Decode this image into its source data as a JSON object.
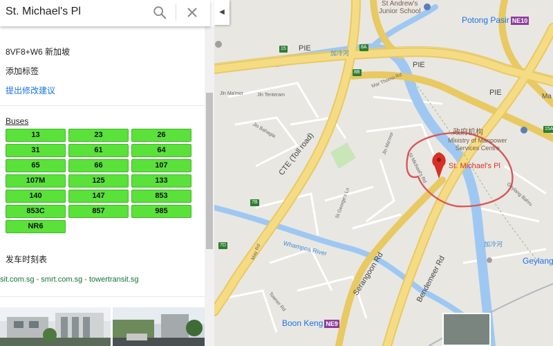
{
  "search": {
    "query": "St. Michael's Pl"
  },
  "place": {
    "plus_code": "8VF8+W6 新加坡",
    "add_label": "添加标签",
    "suggest_edit": "提出修改建议",
    "name_on_map": "St. Michael's Pl"
  },
  "buses": {
    "title": "Buses",
    "chip_color": "#5ae13a",
    "routes": [
      "13",
      "23",
      "26",
      "31",
      "61",
      "64",
      "65",
      "66",
      "107",
      "107M",
      "125",
      "133",
      "140",
      "147",
      "853",
      "853C",
      "857",
      "985",
      "NR6"
    ]
  },
  "timetable": {
    "label": "发车时刻表"
  },
  "links": {
    "a": "sit.com.sg",
    "sep1": " - ",
    "b": "smrt.com.sg",
    "sep2": " - ",
    "c": "towertransit.sg"
  },
  "map": {
    "highway_pie_1": "PIE",
    "highway_pie_2": "PIE",
    "highway_pie_3": "PIE",
    "highway_cte": "CTE (Toll road)",
    "river_kallang": "加冷河",
    "river_kallang_2": "加冷河",
    "river_whampoa": "Whampoa River",
    "road_serangoon": "Serangoon Rd",
    "road_bendemeer": "Bendemeer Rd",
    "road_jin_ma_mor": "Jln Ma'mor",
    "road_jin_tenteram": "Jln Tenteram",
    "road_jin_bahagia": "Jln Bahagia",
    "road_mar_thoma": "Mar Thoma Rd",
    "road_jin_mamor_mid": "Jln Ma'mor",
    "road_st_michaels": "St Michael's Rd",
    "road_st_georges": "St George's Ln",
    "road_towner": "Towner Rd",
    "road_may": "May Rd",
    "road_geylang_bahru": "Geylang Bahru",
    "road_whampoa_dr": "Whampoa Dr",
    "road_lorong": "Lor 8 Toa Payoh",
    "poi_school": "St Andrew's\nJunior School",
    "poi_ministry_cn": "政府机构",
    "poi_ministry": "Ministry of Manpower\nServices Centre",
    "station_potong": "Potong Pasir",
    "station_potong_code": "NE10",
    "station_boon_keng": "Boon Keng",
    "station_boon_keng_code": "NE9",
    "area_geylang": "Geylang",
    "exit_15": "15",
    "exit_8a": "8A",
    "exit_8b": "8B",
    "exit_7b": "7B",
    "exit_7d": "7D",
    "exit_15a": "15A",
    "edge_ma": "Ma"
  }
}
